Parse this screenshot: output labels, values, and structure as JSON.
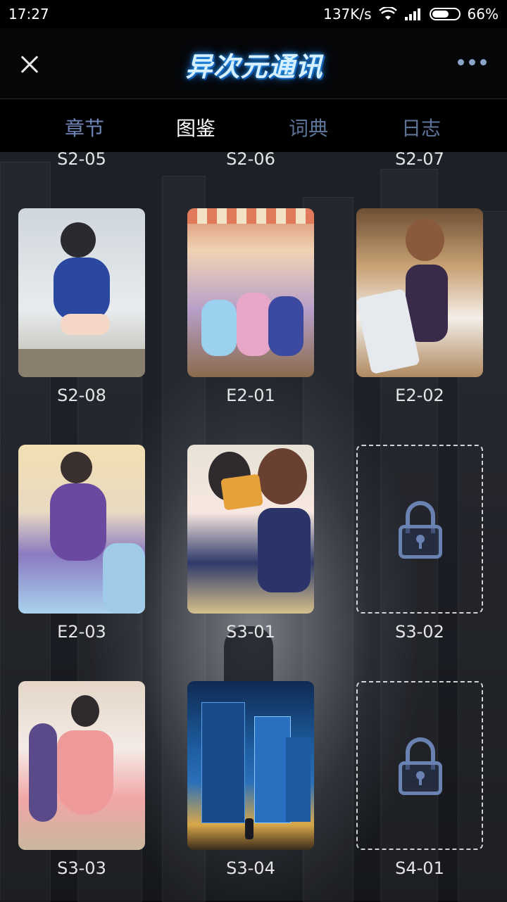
{
  "status_bar": {
    "time": "17:27",
    "net_speed": "137K/s",
    "battery_percent": "66%",
    "battery_level": 0.66
  },
  "header": {
    "logo_text": "异次元通讯"
  },
  "tabs": [
    {
      "label": "章节",
      "active": false
    },
    {
      "label": "图鉴",
      "active": true
    },
    {
      "label": "词典",
      "active": false
    },
    {
      "label": "日志",
      "active": false
    }
  ],
  "gallery": {
    "top_row_labels": [
      "S2-05",
      "S2-06",
      "S2-07"
    ],
    "items": [
      {
        "label": "S2-08",
        "locked": false
      },
      {
        "label": "E2-01",
        "locked": false
      },
      {
        "label": "E2-02",
        "locked": false
      },
      {
        "label": "E2-03",
        "locked": false
      },
      {
        "label": "S3-01",
        "locked": false
      },
      {
        "label": "S3-02",
        "locked": true
      },
      {
        "label": "S3-03",
        "locked": false
      },
      {
        "label": "S3-04",
        "locked": false
      },
      {
        "label": "S4-01",
        "locked": true
      }
    ]
  },
  "colors": {
    "tab_active": "#ffffff",
    "tab_inactive": "#5e7398",
    "lock": "#6a82b2",
    "logo_glow": "#2aa8ff"
  }
}
